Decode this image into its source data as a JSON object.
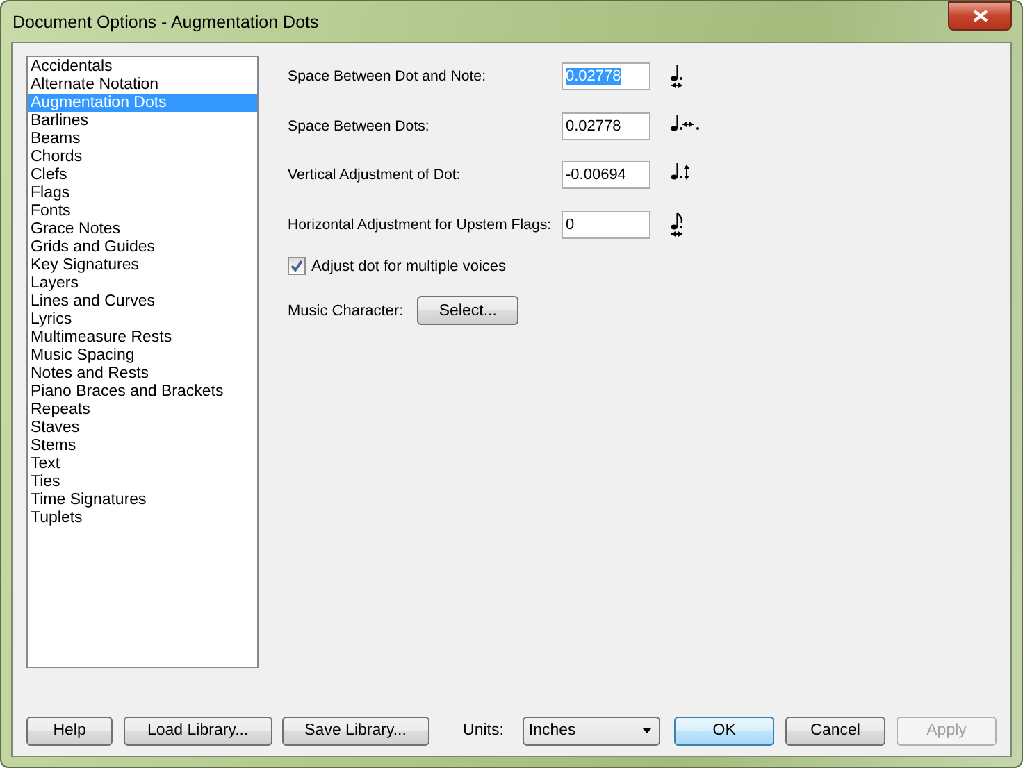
{
  "window": {
    "title": "Document Options - Augmentation Dots"
  },
  "categories": [
    {
      "label": "Accidentals",
      "selected": false
    },
    {
      "label": "Alternate Notation",
      "selected": false
    },
    {
      "label": "Augmentation Dots",
      "selected": true
    },
    {
      "label": "Barlines",
      "selected": false
    },
    {
      "label": "Beams",
      "selected": false
    },
    {
      "label": "Chords",
      "selected": false
    },
    {
      "label": "Clefs",
      "selected": false
    },
    {
      "label": "Flags",
      "selected": false
    },
    {
      "label": "Fonts",
      "selected": false
    },
    {
      "label": "Grace Notes",
      "selected": false
    },
    {
      "label": "Grids and Guides",
      "selected": false
    },
    {
      "label": "Key Signatures",
      "selected": false
    },
    {
      "label": "Layers",
      "selected": false
    },
    {
      "label": "Lines and Curves",
      "selected": false
    },
    {
      "label": "Lyrics",
      "selected": false
    },
    {
      "label": "Multimeasure Rests",
      "selected": false
    },
    {
      "label": "Music Spacing",
      "selected": false
    },
    {
      "label": "Notes and Rests",
      "selected": false
    },
    {
      "label": "Piano Braces and Brackets",
      "selected": false
    },
    {
      "label": "Repeats",
      "selected": false
    },
    {
      "label": "Staves",
      "selected": false
    },
    {
      "label": "Stems",
      "selected": false
    },
    {
      "label": "Text",
      "selected": false
    },
    {
      "label": "Ties",
      "selected": false
    },
    {
      "label": "Time Signatures",
      "selected": false
    },
    {
      "label": "Tuplets",
      "selected": false
    }
  ],
  "fields": [
    {
      "label": "Space Between Dot and Note:",
      "value": "0.02778",
      "selected": true
    },
    {
      "label": "Space Between Dots:",
      "value": "0.02778",
      "selected": false
    },
    {
      "label": "Vertical Adjustment of Dot:",
      "value": "-0.00694",
      "selected": false
    },
    {
      "label": "Horizontal Adjustment for Upstem Flags:",
      "value": "0",
      "selected": false
    }
  ],
  "multiple_voices": {
    "label": "Adjust dot for multiple voices",
    "checked": true
  },
  "music_character": {
    "label": "Music Character:",
    "button": "Select..."
  },
  "footer": {
    "help": "Help",
    "load": "Load Library...",
    "save": "Save Library...",
    "units_label": "Units:",
    "units_value": "Inches",
    "ok": "OK",
    "cancel": "Cancel",
    "apply": "Apply",
    "apply_disabled": true
  }
}
